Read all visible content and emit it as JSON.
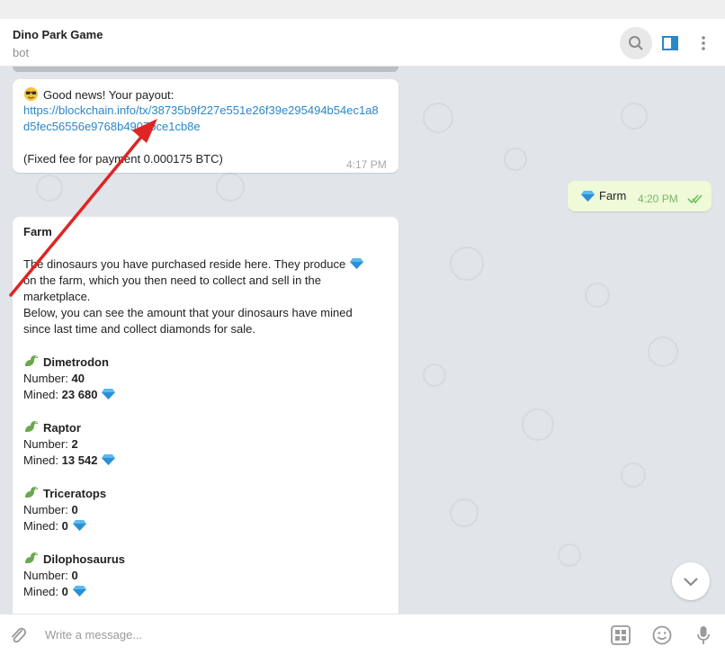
{
  "header": {
    "title": "Dino Park Game",
    "subtitle": "bot"
  },
  "messages": {
    "payout": {
      "greeting": "Good news! Your payout:",
      "link_line1": "https://blockchain.info/tx/38735b9f227e551e26f39e295494b54ec1a8",
      "link_line2": "d5fec56556e9768b4907bce1cb8e",
      "fee": "(Fixed fee for payment 0.000175 BTC)",
      "time": "4:17 PM"
    },
    "outgoing": {
      "text": "Farm",
      "time": "4:20 PM"
    },
    "farm": {
      "title": "Farm",
      "intro_line1": "The dinosaurs you have purchased reside here. They produce",
      "intro_line2": "on the farm, which you then need to collect and sell in the",
      "intro_line3": "marketplace.",
      "intro_line4": " Below, you can see the amount that your dinosaurs have mined",
      "intro_line5": "since last time and collect diamonds for sale.",
      "number_label": "Number:",
      "mined_label": "Mined:",
      "dinos": [
        {
          "name": "Dimetrodon",
          "number": "40",
          "mined": "23 680"
        },
        {
          "name": "Raptor",
          "number": "2",
          "mined": "13 542"
        },
        {
          "name": "Triceratops",
          "number": "0",
          "mined": "0"
        },
        {
          "name": "Dilophosaurus",
          "number": "0",
          "mined": "0"
        }
      ]
    }
  },
  "composer": {
    "placeholder": "Write a message..."
  },
  "icons": {
    "header": [
      "search-icon",
      "sidebar-toggle-icon",
      "more-vertical-icon"
    ],
    "composer": [
      "paperclip-icon",
      "bot-keyboard-icon",
      "emoji-icon",
      "microphone-icon"
    ],
    "scroll": "chevron-down-icon",
    "gem": "diamond-icon",
    "dino": "dinosaur-icon",
    "emoji": "sunglasses-emoji-icon",
    "annotation": "red-arrow"
  },
  "colors": {
    "accent": "#2a87c8",
    "outgoing_bubble": "#eefad8",
    "read_check": "#6fbf5b",
    "arrow": "#e02424",
    "chat_bg": "#e1e5e9"
  }
}
